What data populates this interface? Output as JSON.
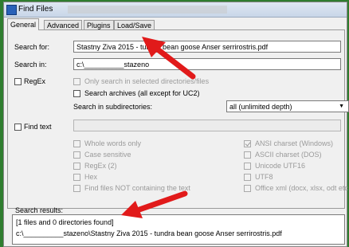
{
  "window": {
    "title": "Find Files"
  },
  "tabs": [
    {
      "label": "General"
    },
    {
      "label": "Advanced"
    },
    {
      "label": "Plugins"
    },
    {
      "label": "Load/Save"
    }
  ],
  "general": {
    "search_for_label": "Search for:",
    "search_for_value": "Stastny Ziva 2015 - tundra bean goose Anser serrirostris.pdf",
    "search_in_label": "Search in:",
    "search_in_value": "c:\\__________stazeno",
    "regex_label": "RegEx",
    "only_selected_label": "Only search in selected directories/files",
    "search_archives_label": "Search archives (all except for UC2)",
    "subdirs_label": "Search in subdirectories:",
    "subdirs_value": "all (unlimited depth)",
    "find_text_label": "Find text",
    "options": {
      "whole_words": "Whole words only",
      "case_sensitive": "Case sensitive",
      "regex2": "RegEx (2)",
      "hex": "Hex",
      "files_not_containing": "Find files NOT containing the text",
      "ansi": "ANSI charset (Windows)",
      "ascii": "ASCII charset (DOS)",
      "unicode": "Unicode UTF16",
      "utf8": "UTF8",
      "office_xml": "Office xml (docx, xlsx, odt etc"
    }
  },
  "results": {
    "label": "Search results:",
    "summary": "[1 files and 0 directories found]",
    "item": "c:\\__________stazeno\\Stastny Ziva 2015 - tundra bean goose Anser serrirostris.pdf"
  },
  "colors": {
    "annotation_arrow": "#e11a1a"
  }
}
